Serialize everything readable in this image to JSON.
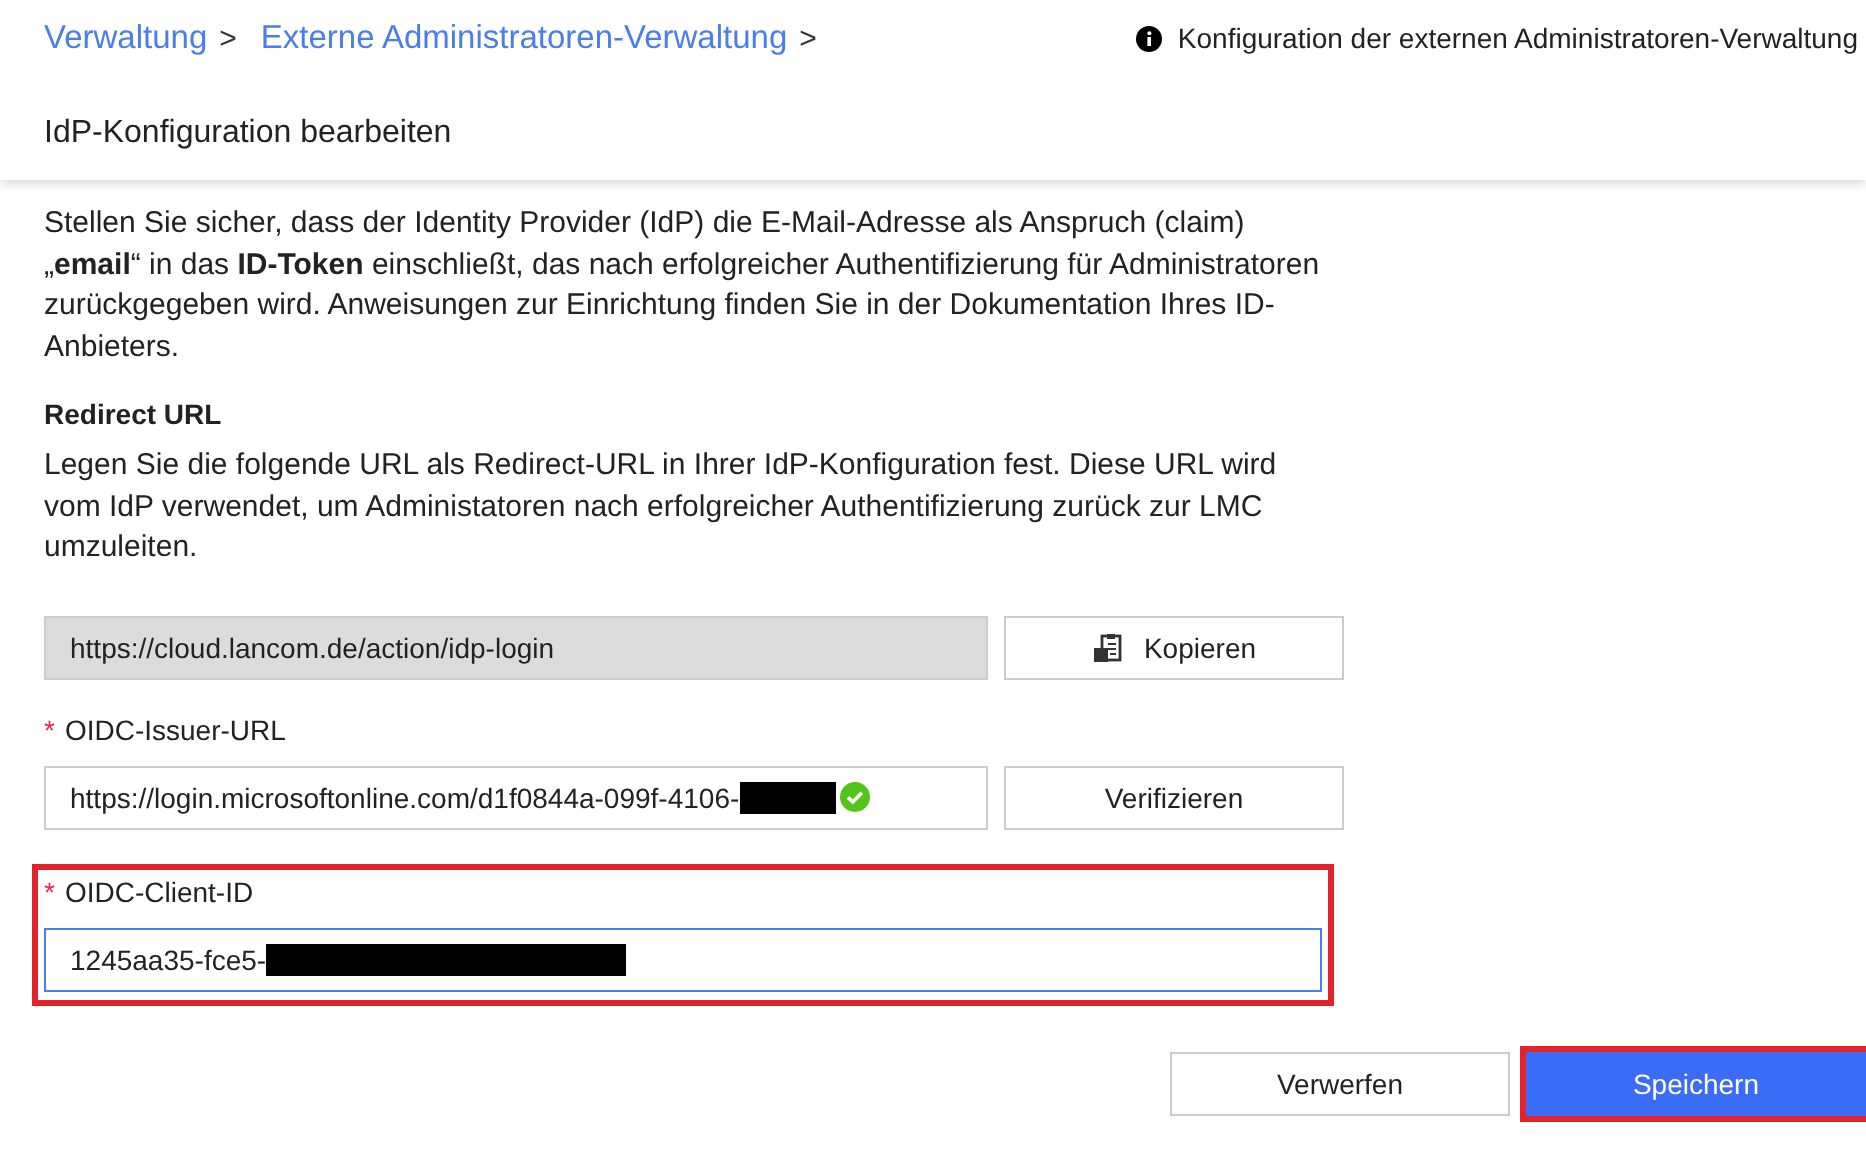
{
  "breadcrumb": [
    {
      "label": "Verwaltung",
      "separator": ">"
    },
    {
      "label": "Externe Administratoren-Verwaltung",
      "separator": ">"
    }
  ],
  "info": {
    "text": "Konfiguration der externen Administratoren-Verwaltung"
  },
  "page_title": "IdP-Konfiguration bearbeiten",
  "intro": "Stellen Sie sicher, dass der Identity Provider (IdP) die E-Mail-Adresse als Anspruch (claim) „**email**“ in das **ID-Token** einschließt, das nach erfolgreicher Authentifizierung für Administratoren zurückgegeben wird. Anweisungen zur Einrichtung finden Sie in der Dokumentation Ihres ID-Anbieters.",
  "redirect": {
    "heading": "Redirect URL",
    "text": "Legen Sie die folgende URL als Redirect-URL in Ihrer IdP-Konfiguration fest. Diese URL wird vom IdP verwendet, um Administatoren nach erfolgreicher Authentifizierung zurück zur LMC umzuleiten.",
    "url": "https://cloud.lancom.de/action/idp-login",
    "button": "Kopieren"
  },
  "fields": [
    {
      "label": "OIDC-Issuer-URL",
      "required": true,
      "required_mark": "*",
      "value": "https://login.microsoftonline.com/d1f0844a-099f-4106-",
      "verified": true,
      "focused": false,
      "highlighted": false,
      "button": "Verifizieren"
    },
    {
      "label": "OIDC-Client-ID",
      "required": true,
      "required_mark": "*",
      "value": "1245aa35-fce5-",
      "verified": false,
      "focused": true,
      "highlighted": true
    }
  ],
  "actions": [
    {
      "label": "Verwerfen",
      "kind": "secondary",
      "highlighted": false
    },
    {
      "label": "Speichern",
      "kind": "primary",
      "highlighted": true
    }
  ]
}
